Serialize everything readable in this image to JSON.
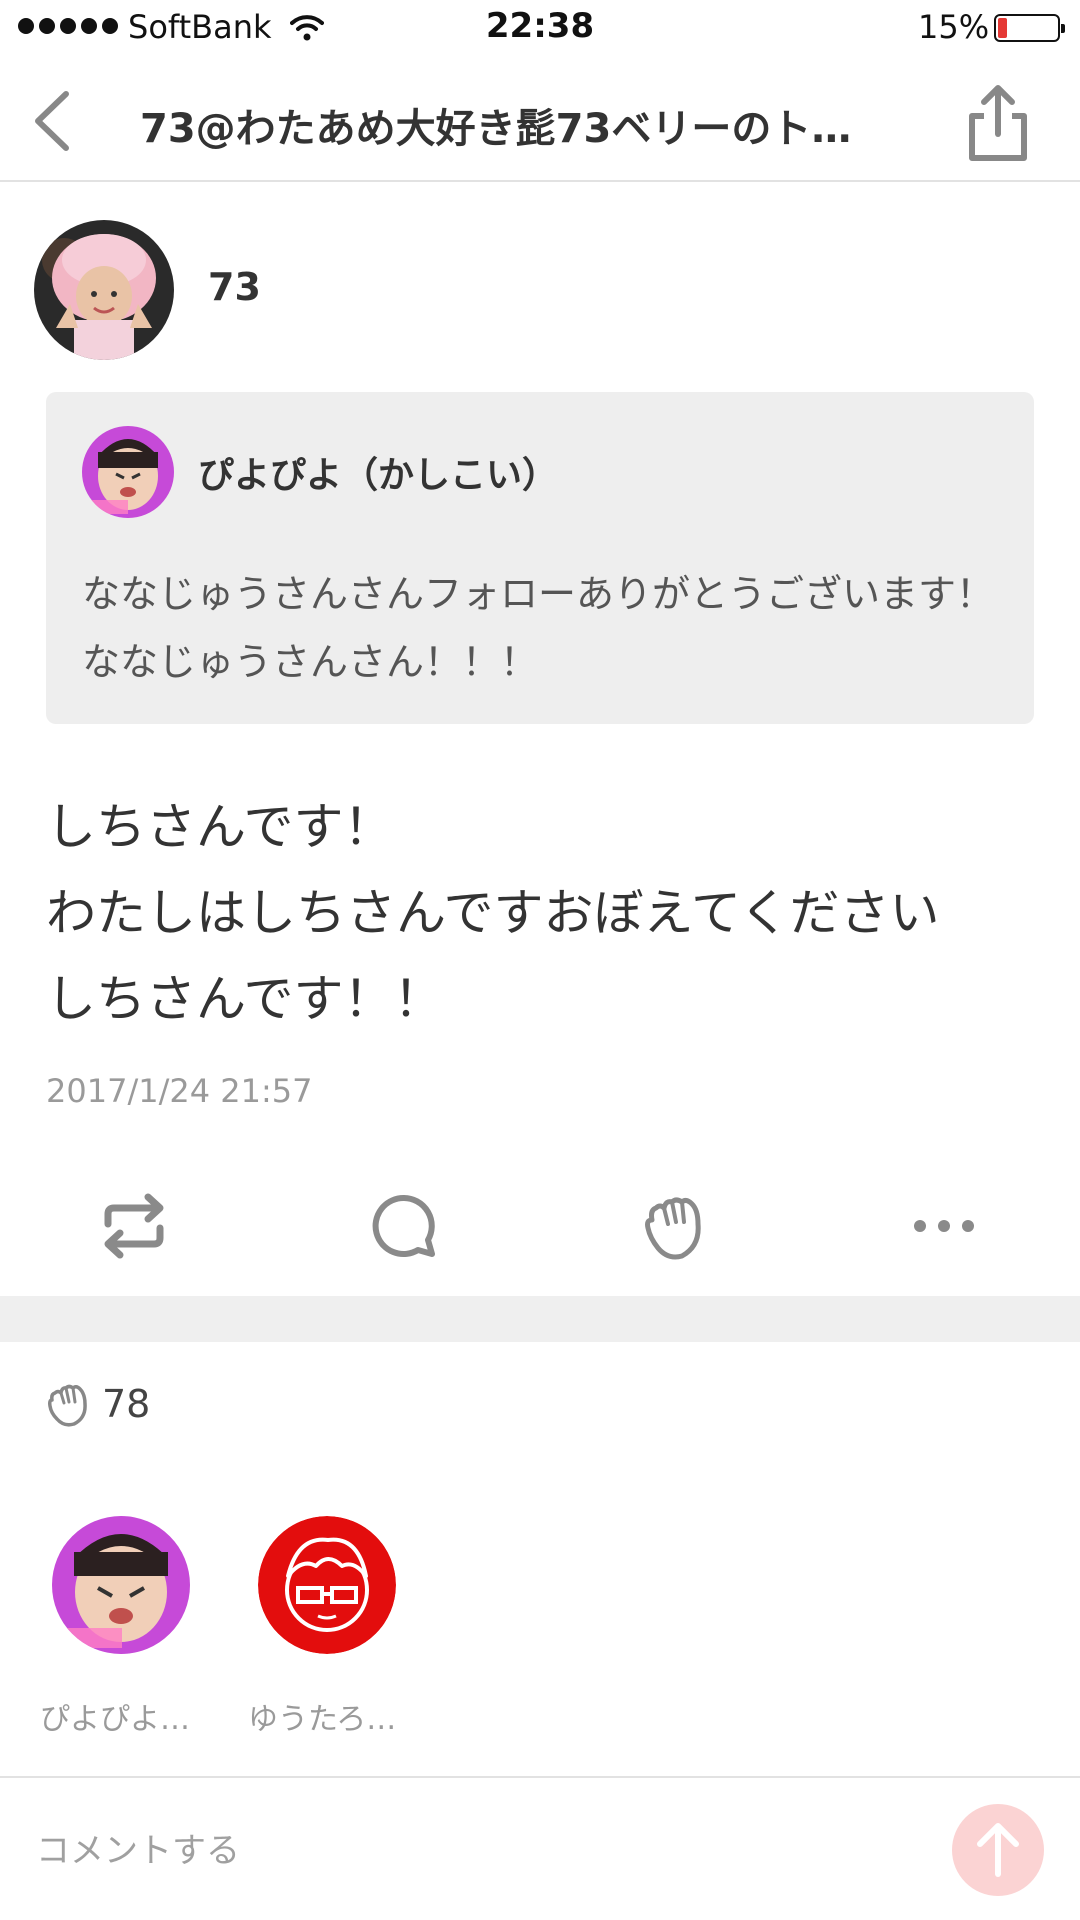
{
  "status_bar": {
    "carrier": "SoftBank",
    "time": "22:38",
    "battery": "15%",
    "battery_level": 0.15
  },
  "nav": {
    "title": "73@わたあめ大好き髭73ベリーのト…",
    "back_icon": "chevron-left-icon",
    "share_icon": "share-icon"
  },
  "author": {
    "name": "73"
  },
  "quote": {
    "user_name": "ぴよぴよ（かしこい）",
    "text": "ななじゅうさんさんフォローありがとうございます！ななじゅうさんさん！！！"
  },
  "post": {
    "text": "しちさんです！\nわたしはしちさんですおぼえてください\nしちさんです！！",
    "date": "2017/1/24 21:57"
  },
  "actions": [
    "repost-icon",
    "comment-icon",
    "clap-icon",
    "more-icon"
  ],
  "likes": {
    "count": "78",
    "users": [
      {
        "name": "ぴよぴよ…"
      },
      {
        "name": "ゆうたろ…"
      }
    ]
  },
  "comment": {
    "placeholder": "コメントする"
  },
  "colors": {
    "accent": "#f9caca",
    "battery_low": "#e53935",
    "band": "#efefef",
    "quote_bg": "#eeeeee",
    "avatar_red": "#e30d0d"
  }
}
